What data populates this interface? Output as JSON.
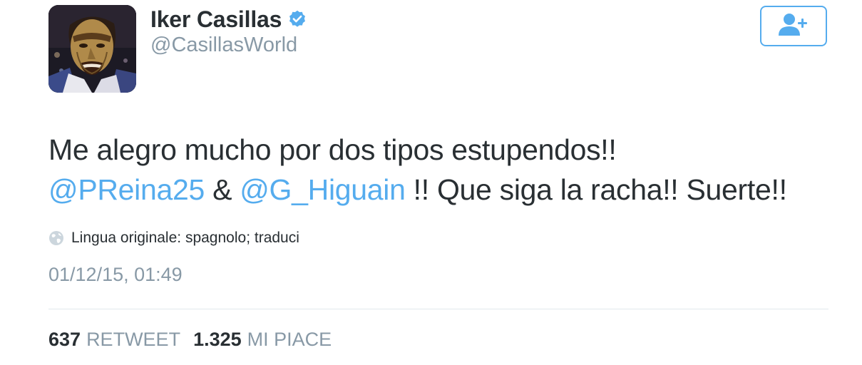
{
  "user": {
    "display_name": "Iker Casillas",
    "handle": "@CasillasWorld",
    "verified": true,
    "avatar_icon": "avatar-illustration"
  },
  "follow_button": {
    "icon": "add-user-icon",
    "color": "#55acee"
  },
  "tweet": {
    "line1": "Me alegro mucho por dos tipos estupendos!!",
    "mention1": "@PReina25",
    "separator": " & ",
    "mention2": "@G_Higuain",
    "line2_rest": " !! Que siga la racha!! Suerte!!"
  },
  "translation": {
    "icon": "globe-icon",
    "text": "Lingua originale: spagnolo; traduci"
  },
  "timestamp": "01/12/15, 01:49",
  "stats": {
    "retweet_count": "637",
    "retweet_label": "RETWEET",
    "like_count": "1.325",
    "like_label": "MI PIACE"
  },
  "colors": {
    "accent": "#55acee",
    "text": "#292f33",
    "muted": "#8899a6",
    "divider": "#e1e8ed"
  }
}
